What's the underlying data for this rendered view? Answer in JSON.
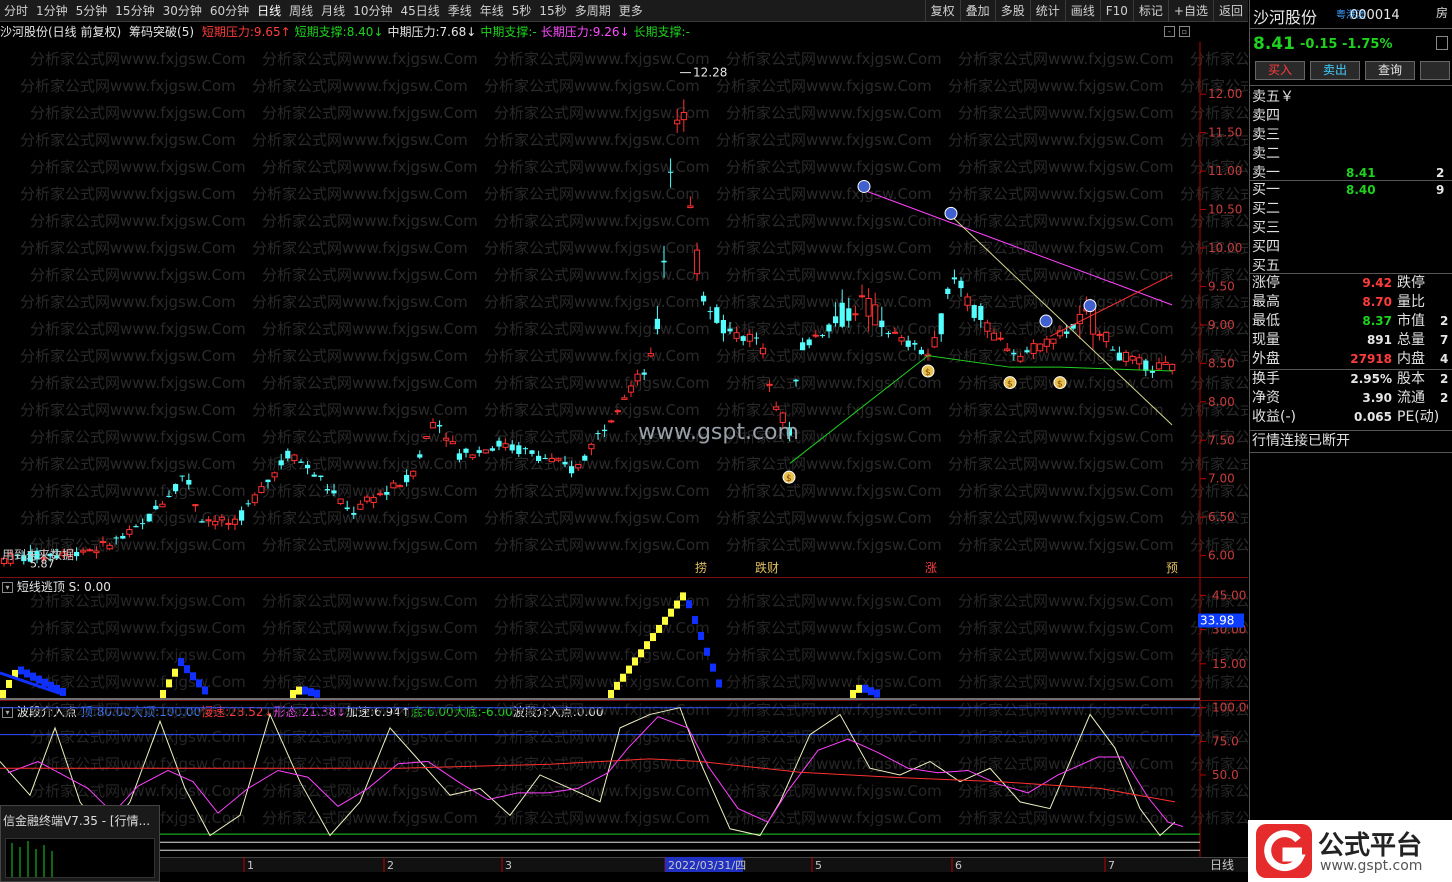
{
  "toolbar": {
    "periods": [
      "分时",
      "1分钟",
      "5分钟",
      "15分钟",
      "30分钟",
      "60分钟",
      "日线",
      "周线",
      "月线",
      "10分钟",
      "45日线",
      "季线",
      "年线",
      "5秒",
      "15秒",
      "多周期",
      "更多"
    ],
    "active_period": "日线",
    "buttons": [
      "复权",
      "叠加",
      "多股",
      "统计",
      "画线",
      "F10",
      "标记",
      "+自选",
      "返回"
    ]
  },
  "info": {
    "title": "沙河股份(日线 前复权)",
    "indicator": "筹码突破(5)",
    "items": [
      {
        "label": "短期压力:",
        "value": "9.65",
        "arrow": "↑",
        "color": "red"
      },
      {
        "label": "短期支撑:",
        "value": "8.40",
        "arrow": "↓",
        "color": "grn"
      },
      {
        "label": "中期压力:",
        "value": "7.68",
        "arrow": "↓",
        "color": "wht"
      },
      {
        "label": "中期支撑:",
        "value": "-",
        "arrow": "",
        "color": "grn"
      },
      {
        "label": "长期压力:",
        "value": "9.26",
        "arrow": "↓",
        "color": "mag"
      },
      {
        "label": "长期支撑:",
        "value": "-",
        "arrow": "",
        "color": "grn"
      }
    ]
  },
  "main_chart": {
    "price_ticks": [
      12.0,
      11.5,
      11.0,
      10.5,
      10.0,
      9.5,
      9.0,
      8.5,
      8.0,
      7.5,
      7.0,
      6.5,
      6.0
    ],
    "ymin": 5.8,
    "ymax": 12.6,
    "high_label": "12.28",
    "low_label": "5.87",
    "watermark": "www.gspt.com",
    "bg_watermark": "分析家公式网www.fxjgsw.Com",
    "markers": [
      "捞",
      "跌财",
      "涨",
      "预"
    ],
    "future_label": "用到未来数据"
  },
  "sub1": {
    "title": "短线逃顶",
    "value_label": "S: 0.00",
    "ticks": [
      45.0,
      30.0,
      15.0
    ],
    "current_value": "33.98"
  },
  "sub2": {
    "title": "波段介入点",
    "items": [
      {
        "label": "顶:",
        "value": "80.00",
        "color": "blu"
      },
      {
        "label": "大顶:",
        "value": "100.00",
        "color": "blu"
      },
      {
        "label": "慢速:",
        "value": "28.52",
        "arrow": "↓",
        "color": "red"
      },
      {
        "label": "形态:",
        "value": "21.38",
        "arrow": "↓",
        "color": "mag"
      },
      {
        "label": "加速:",
        "value": "6.94",
        "arrow": "↑",
        "color": "wht"
      },
      {
        "label": "底:",
        "value": "6.00",
        "color": "grn"
      },
      {
        "label": "大底:",
        "value": "-6.00",
        "color": "grn"
      },
      {
        "label": "波段介入点:",
        "value": "0.00",
        "color": "wht"
      }
    ],
    "ticks": [
      100.0,
      75.0,
      50.0
    ]
  },
  "timeline": {
    "labels": [
      "1",
      "2",
      "3",
      "2022/03/31/四",
      "5",
      "6",
      "7"
    ],
    "period_label": "日线"
  },
  "quote": {
    "name": "沙河股份",
    "hk_badge": "粤港澳",
    "code": "000014",
    "edge_btn": "房",
    "price": "8.41",
    "change": "-0.15",
    "pct": "-1.75%",
    "buttons": [
      "买入",
      "卖出",
      "查询"
    ],
    "asks": [
      {
        "label": "卖五",
        "price": "",
        "vol": "",
        "suffix": "￥"
      },
      {
        "label": "卖四",
        "price": "",
        "vol": ""
      },
      {
        "label": "卖三",
        "price": "",
        "vol": ""
      },
      {
        "label": "卖二",
        "price": "",
        "vol": ""
      },
      {
        "label": "卖一",
        "price": "8.41",
        "vol": "2"
      }
    ],
    "bids": [
      {
        "label": "买一",
        "price": "8.40",
        "vol": "9"
      },
      {
        "label": "买二",
        "price": "",
        "vol": ""
      },
      {
        "label": "买三",
        "price": "",
        "vol": ""
      },
      {
        "label": "买四",
        "price": "",
        "vol": ""
      },
      {
        "label": "买五",
        "price": "",
        "vol": ""
      }
    ],
    "stats": [
      {
        "l1": "涨停",
        "v1": "9.42",
        "c1": "red",
        "l2": "跌停",
        "v2": ""
      },
      {
        "l1": "最高",
        "v1": "8.70",
        "c1": "red",
        "l2": "量比",
        "v2": ""
      },
      {
        "l1": "最低",
        "v1": "8.37",
        "c1": "grn",
        "l2": "市值",
        "v2": "2"
      },
      {
        "l1": "现量",
        "v1": "891",
        "c1": "wht",
        "l2": "总量",
        "v2": "7"
      },
      {
        "l1": "外盘",
        "v1": "27918",
        "c1": "red",
        "l2": "内盘",
        "v2": "4"
      }
    ],
    "stats2": [
      {
        "l1": "换手",
        "v1": "2.95%",
        "l2": "股本",
        "v2": "2"
      },
      {
        "l1": "净资",
        "v1": "3.90",
        "l2": "流通",
        "v2": "2"
      },
      {
        "l1": "收益(-)",
        "v1": "0.065",
        "l2": "PE(动)",
        "v2": ""
      }
    ],
    "status": "行情连接已断开"
  },
  "taskbar": {
    "title": "信金融终端V7.35 - [行情..."
  },
  "logo": {
    "text": "公式平台",
    "url": "www.gspt.com"
  }
}
